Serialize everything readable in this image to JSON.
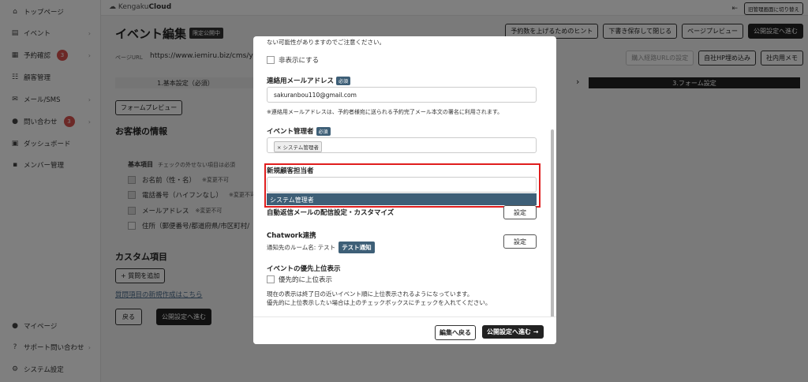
{
  "sidebar": {
    "items": [
      {
        "label": "トップページ",
        "icon": "home-icon"
      },
      {
        "label": "イベント",
        "icon": "document-icon"
      },
      {
        "label": "予約確認",
        "icon": "calendar-icon",
        "badge": "3"
      },
      {
        "label": "顧客管理",
        "icon": "users-icon"
      },
      {
        "label": "メール/SMS",
        "icon": "mail-icon"
      },
      {
        "label": "問い合わせ",
        "icon": "chat-icon",
        "badge": "3"
      },
      {
        "label": "ダッシュボード",
        "icon": "dashboard-icon"
      },
      {
        "label": "メンバー管理",
        "icon": "grid-icon"
      }
    ],
    "bottom": [
      {
        "label": "マイページ",
        "icon": "person-icon"
      },
      {
        "label": "サポート問い合わせ",
        "icon": "help-icon"
      },
      {
        "label": "システム設定",
        "icon": "gear-icon"
      }
    ]
  },
  "topbar": {
    "logo": "Kengaku",
    "logo_bold": "Cloud",
    "switch_label": "旧管理画面に切り替え"
  },
  "header": {
    "title": "イベント編集",
    "tag": "限定公開中",
    "actions": [
      "予約数を上げるためのヒント",
      "下書き保存して閉じる",
      "ページプレビュー",
      "公開設定へ進む"
    ],
    "url_label": "ページURL",
    "url": "https://www.iemiru.biz/cms/yo",
    "url_actions": [
      "購入経路URLの設定",
      "自社HP埋め込み",
      "社内用メモ"
    ]
  },
  "steps": {
    "step1": "1.基本設定（必須）",
    "step3": "3.フォーム設定"
  },
  "form": {
    "preview": "フォームプレビュー",
    "customer_info": "お客様の情報",
    "basic_items": "基本項目",
    "basic_note": "チェックの外せない項目は必須",
    "fields": [
      {
        "label": "お名前（性・名）",
        "note": "※変更不可"
      },
      {
        "label": "電話番号（ハイフンなし）",
        "note": "※変更不可"
      },
      {
        "label": "メールアドレス",
        "note": "※変更不可"
      },
      {
        "label": "住所（郵便番号/都道府県/市区町村/",
        "note": ""
      }
    ],
    "custom": "カスタム項目",
    "add_question": "+ 質問を追加",
    "new_question_link": "質問項目の新規作成はこちら",
    "back": "戻る",
    "next": "公開設定へ進む"
  },
  "modal": {
    "top_note": "ない可能性がありますのでご注意ください。",
    "hide_label": "非表示にする",
    "contact_email_label": "連絡用メールアドレス",
    "required": "必須",
    "contact_email_value": "sakuranbou110@gmail.com",
    "contact_email_note": "※連絡用メールアドレスは、予約者様宛に送られる予約完了メール本文の署名に利用されます。",
    "manager_label": "イベント管理者",
    "manager_chip": "× システム管理者",
    "new_customer_label": "新規顧客担当者",
    "new_customer_value": "",
    "dropdown_option": "システム管理者",
    "auto_reply_label": "自動返信メールの配信設定・カスタマイズ",
    "setting": "設定",
    "chatwork_label": "Chatwork連携",
    "chatwork_room": "通知先のルーム名: テスト",
    "test_notify": "テスト通知",
    "priority_label": "イベントの優先上位表示",
    "priority_checkbox": "優先的に上位表示",
    "priority_note1": "現在の表示は終了日の近いイベント順に上位表示されるようになっています。",
    "priority_note2": "優先的に上位表示したい場合は上のチェックボックスにチェックを入れてください。",
    "footer_back": "編集へ戻る",
    "footer_next": "公開設定へ進む →"
  }
}
